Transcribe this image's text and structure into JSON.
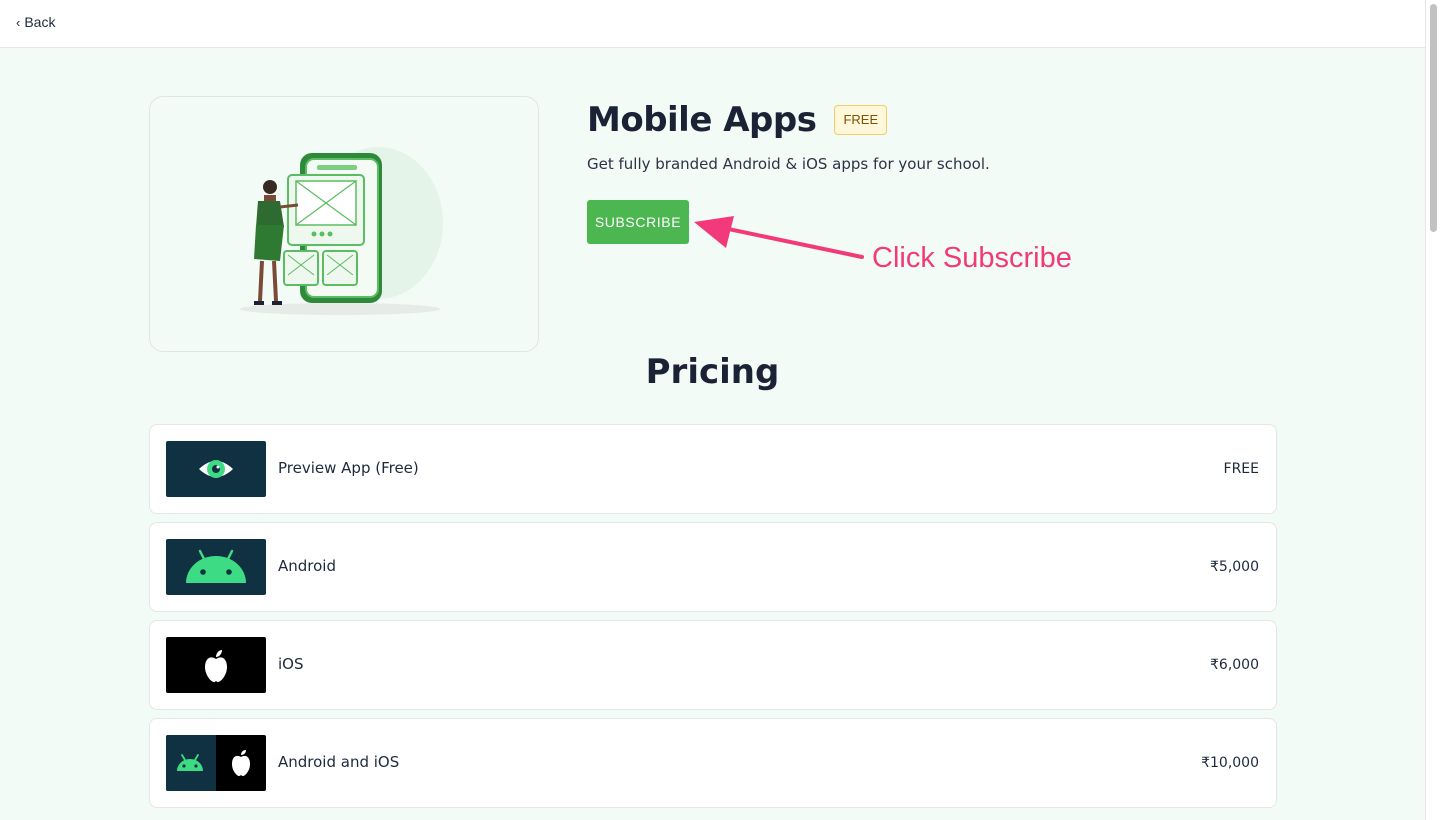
{
  "nav": {
    "back_label": "Back",
    "back_icon": "chevron-left-icon"
  },
  "product": {
    "title": "Mobile Apps",
    "badge": "FREE",
    "description": "Get fully branded Android & iOS apps for your school.",
    "subscribe_label": "SUBSCRIBE",
    "accent_color": "#4cb650"
  },
  "annotation": {
    "text": "Click Subscribe",
    "color": "#f23a7a"
  },
  "pricing": {
    "title": "Pricing",
    "plans": [
      {
        "name": "Preview App (Free)",
        "price": "FREE",
        "icon": "eye-icon"
      },
      {
        "name": "Android",
        "price": "₹5,000",
        "icon": "android-icon"
      },
      {
        "name": "iOS",
        "price": "₹6,000",
        "icon": "apple-icon"
      },
      {
        "name": "Android and iOS",
        "price": "₹10,000",
        "icon": "android-apple-icon"
      }
    ]
  }
}
